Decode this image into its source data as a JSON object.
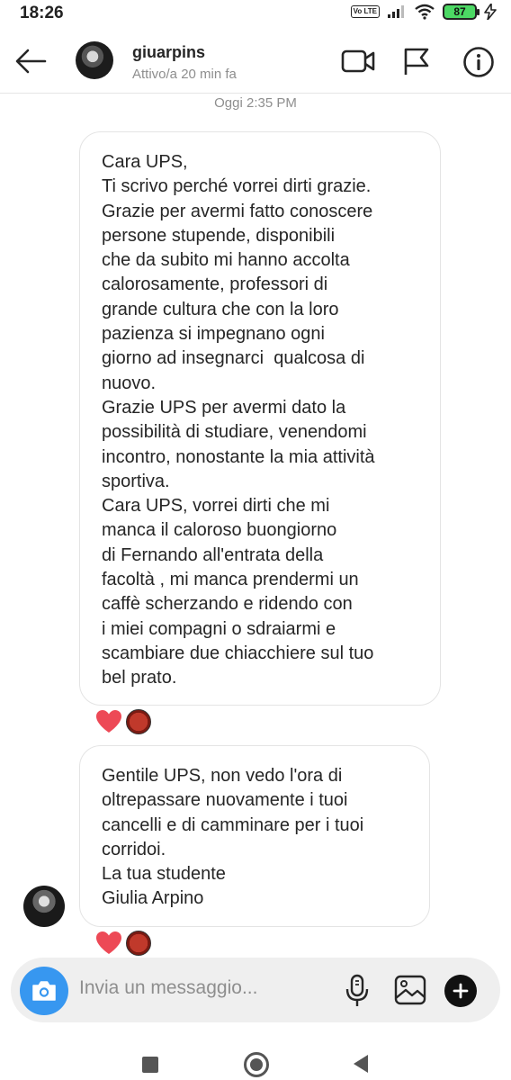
{
  "status_bar": {
    "time": "18:26",
    "network_badge": "Vo LTE",
    "battery_level": "87"
  },
  "header": {
    "username": "giuarpins",
    "activity_status": "Attivo/a 20 min fa",
    "icons": [
      "back-arrow-icon",
      "video-call-icon",
      "flag-icon",
      "info-icon"
    ]
  },
  "chat": {
    "timestamp": "Oggi 2:35 PM",
    "messages": [
      {
        "text": "Cara UPS,\nTi scrivo perché vorrei dirti grazie.\nGrazie per avermi fatto conoscere\npersone stupende, disponibili\nche da subito mi hanno accolta\ncalorosamente, professori di\ngrande cultura che con la loro\npazienza si impegnano ogni\ngiorno ad insegnarci  qualcosa di\nnuovo.\nGrazie UPS per avermi dato la\npossibilità di studiare, venendomi\nincontro, nonostante la mia attività\nsportiva.\nCara UPS, vorrei dirti che mi\nmanca il caloroso buongiorno\ndi Fernando all'entrata della\nfacoltà , mi manca prendermi un\ncaffè scherzando e ridendo con\ni miei compagni o sdraiarmi e\nscambiare due chiacchiere sul tuo\nbel prato.",
        "reactions": [
          "heart",
          "user-avatar"
        ]
      },
      {
        "text": "Gentile UPS, non vedo l'ora di\noltrepassare nuovamente i tuoi\ncancelli e di camminare per i tuoi\ncorridoi.\nLa tua studente\nGiulia Arpino",
        "reactions": [
          "heart",
          "user-avatar"
        ]
      }
    ]
  },
  "composer": {
    "placeholder": "Invia un messaggio..."
  },
  "colors": {
    "accent": "#3797f0",
    "heart": "#ed4956",
    "battery": "#4cd964"
  }
}
